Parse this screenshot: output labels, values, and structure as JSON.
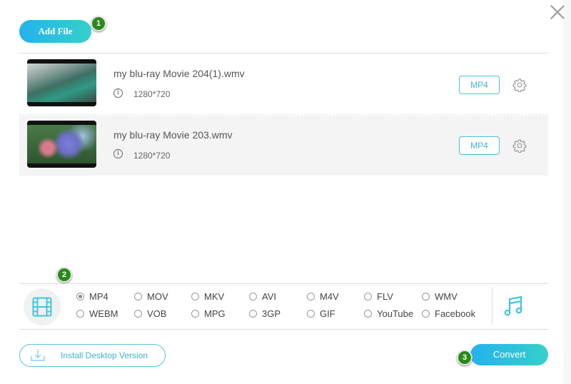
{
  "header": {
    "add_file_label": "Add File",
    "step_badges": [
      "1",
      "2",
      "3"
    ]
  },
  "files": [
    {
      "name": "my blu-ray Movie 204(1).wmv",
      "info_icon": "i",
      "resolution": "1280*720",
      "format": "MP4"
    },
    {
      "name": "my blu-ray Movie 203.wmv",
      "info_icon": "i",
      "resolution": "1280*720",
      "format": "MP4"
    }
  ],
  "formats": {
    "selected": "MP4",
    "options": [
      "MP4",
      "MOV",
      "MKV",
      "AVI",
      "M4V",
      "FLV",
      "WMV",
      "WEBM",
      "VOB",
      "MPG",
      "3GP",
      "GIF",
      "YouTube",
      "Facebook"
    ]
  },
  "footer": {
    "install_label": "Install Desktop Version",
    "convert_label": "Convert"
  },
  "colors": {
    "accent_start": "#24b2ef",
    "accent_end": "#35d0c9",
    "badge_green": "#2a8a1a"
  }
}
